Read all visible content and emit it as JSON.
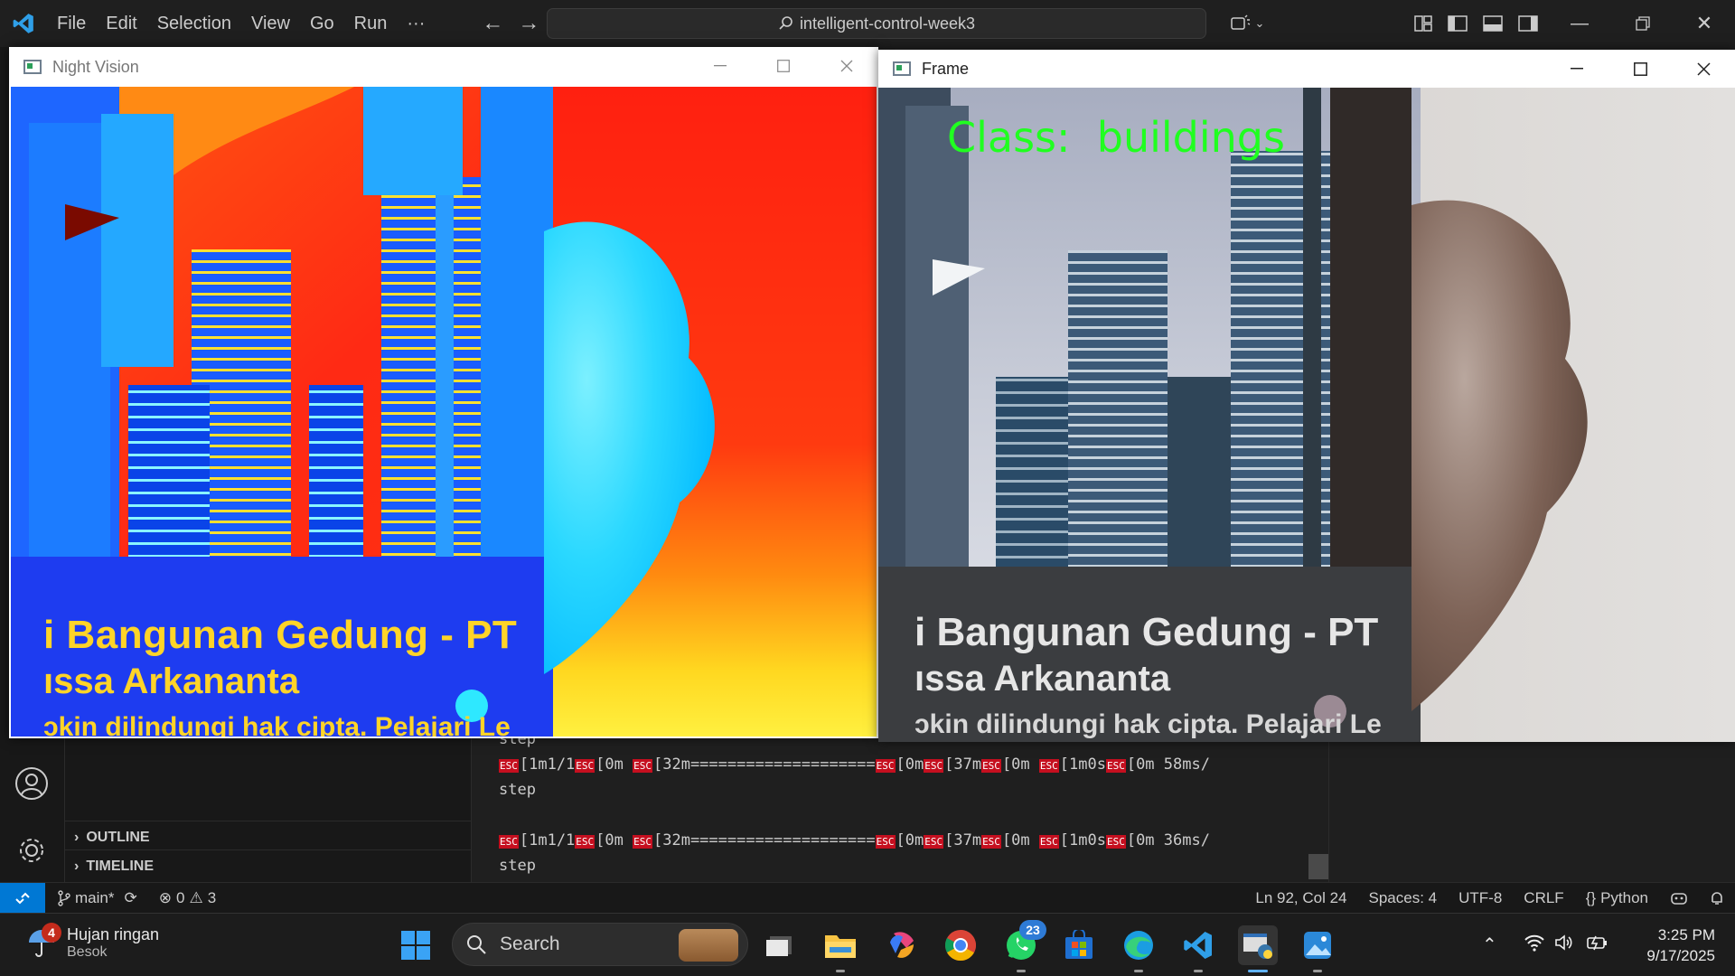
{
  "vscode": {
    "menu": [
      "File",
      "Edit",
      "Selection",
      "View",
      "Go",
      "Run",
      "···"
    ],
    "search_text": "intelligent-control-week3",
    "sidebar_sections": [
      "OUTLINE",
      "TIMELINE"
    ],
    "terminal_lines": [
      {
        "kind": "plain",
        "text": "step"
      },
      {
        "kind": "progress",
        "parts": [
          "[1m1/1",
          "[0m ",
          "[32m====================",
          "[0m",
          "[37m",
          "[0m ",
          "[1m0s",
          "[0m 58ms/"
        ]
      },
      {
        "kind": "plain",
        "text": "step"
      },
      {
        "kind": "plain",
        "text": ""
      },
      {
        "kind": "progress",
        "parts": [
          "[1m1/1",
          "[0m ",
          "[32m====================",
          "[0m",
          "[37m",
          "[0m ",
          "[1m0s",
          "[0m 36ms/"
        ]
      },
      {
        "kind": "plain",
        "text": "step"
      }
    ],
    "esc_label": "ESC",
    "statusbar": {
      "branch": "main*",
      "errors": "0",
      "warnings": "3",
      "position": "Ln 92, Col 24",
      "spaces": "Spaces: 4",
      "encoding": "UTF-8",
      "eol": "CRLF",
      "language": "Python"
    }
  },
  "windows": {
    "night_vision": {
      "title": "Night Vision",
      "sign_line1": "i Bangunan Gedung - PT",
      "sign_line2": "ıssa Arkananta",
      "sign_line3": "ɔkin dilindungi hak cipta. Pelajari Le"
    },
    "frame": {
      "title": "Frame",
      "class_label": "Class:  buildings",
      "sign_line1": "i Bangunan Gedung - PT",
      "sign_line2": "ıssa Arkananta",
      "sign_line3": "ɔkin dilindungi hak cipta. Pelajari Le"
    }
  },
  "taskbar": {
    "weather_title": "Hujan ringan",
    "weather_sub": "Besok",
    "weather_badge": "4",
    "search_label": "Search",
    "whatsapp_badge": "23",
    "time": "3:25 PM",
    "date": "9/17/2025"
  }
}
